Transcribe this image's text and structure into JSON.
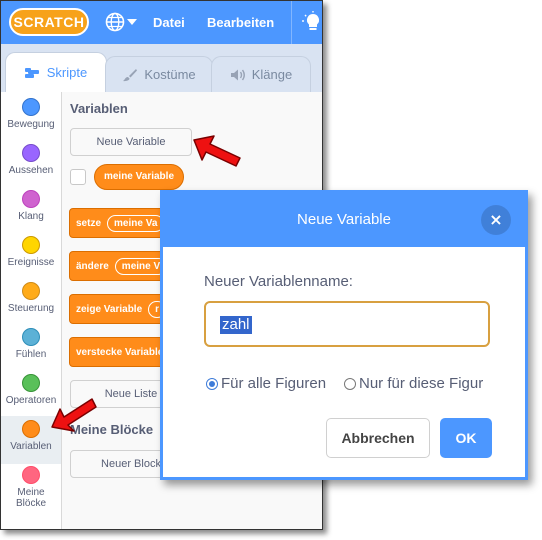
{
  "menubar": {
    "logo": "SCRATCH",
    "items": [
      "Datei",
      "Bearbeiten"
    ]
  },
  "tabs": [
    {
      "label": "Skripte",
      "icon": "code-icon"
    },
    {
      "label": "Kostüme",
      "icon": "brush-icon"
    },
    {
      "label": "Klänge",
      "icon": "speaker-icon"
    }
  ],
  "categories": [
    {
      "label": "Bewegung",
      "color": "#4c97ff"
    },
    {
      "label": "Aussehen",
      "color": "#9966ff"
    },
    {
      "label": "Klang",
      "color": "#cf63cf"
    },
    {
      "label": "Ereignisse",
      "color": "#ffd500"
    },
    {
      "label": "Steuerung",
      "color": "#ffab19"
    },
    {
      "label": "Fühlen",
      "color": "#5cb1d6"
    },
    {
      "label": "Operatoren",
      "color": "#59c059"
    },
    {
      "label": "Variablen",
      "color": "#ff8c1a"
    },
    {
      "label": "Meine Blöcke",
      "color": "#ff6680"
    }
  ],
  "palette": {
    "variables_title": "Variablen",
    "new_variable_button": "Neue Variable",
    "variable_reporter": "meine Variable",
    "blocks": [
      {
        "text": "setze",
        "slot": "meine Va"
      },
      {
        "text": "ändere",
        "slot": "meine V"
      },
      {
        "text": "zeige Variable",
        "slot": "r"
      },
      {
        "text": "verstecke Variable",
        "slot": ""
      }
    ],
    "new_list_button": "Neue Liste",
    "my_blocks_title": "Meine Blöcke",
    "new_block_button": "Neuer Block"
  },
  "dialog": {
    "title": "Neue Variable",
    "close": "×",
    "name_label": "Neuer Variablenname:",
    "name_value": "zahl",
    "options": [
      {
        "label": "Für alle Figuren",
        "selected": true
      },
      {
        "label": "Nur für diese Figur",
        "selected": false
      }
    ],
    "cancel_label": "Abbrechen",
    "ok_label": "OK"
  },
  "colors": {
    "accent": "#4c97ff",
    "variables": "#ff8c1a",
    "arrow": "#ee1111"
  }
}
